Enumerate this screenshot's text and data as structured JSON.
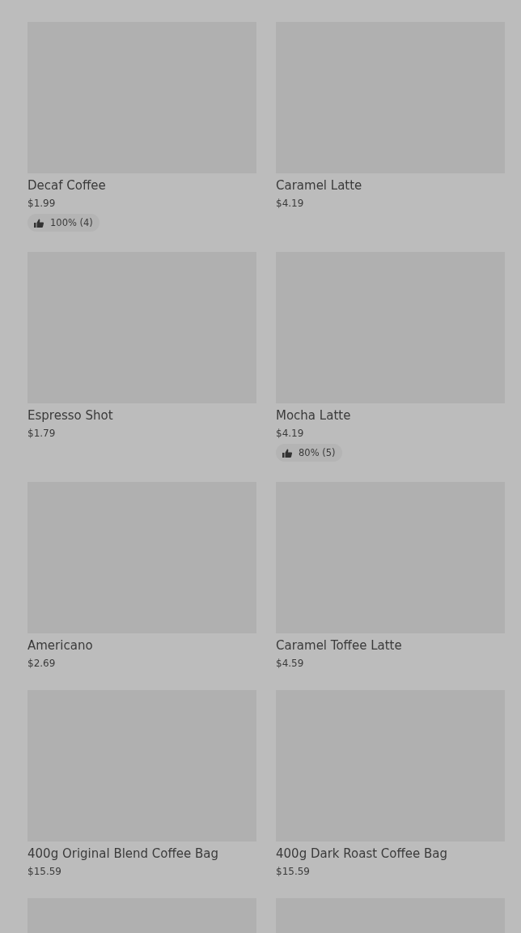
{
  "products": [
    {
      "name": "Decaf Coffee",
      "price": "$1.99",
      "rating": "100% (4)"
    },
    {
      "name": "Caramel Latte",
      "price": "$4.19"
    },
    {
      "name": "Espresso Shot",
      "price": "$1.79"
    },
    {
      "name": "Mocha Latte",
      "price": "$4.19",
      "rating": "80% (5)"
    },
    {
      "name": "Americano",
      "price": "$2.69"
    },
    {
      "name": "Caramel Toffee Latte",
      "price": "$4.59"
    },
    {
      "name": "400g Original Blend Coffee Bag",
      "price": "$15.59"
    },
    {
      "name": "400g Dark Roast Coffee Bag",
      "price": "$15.59"
    },
    {
      "kind": "picture"
    },
    {
      "kind": "picture"
    }
  ]
}
